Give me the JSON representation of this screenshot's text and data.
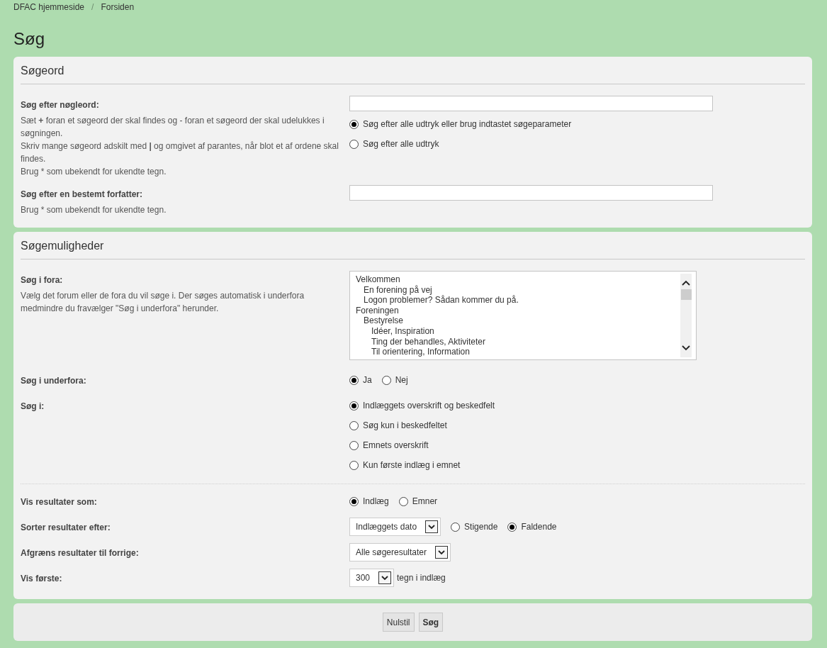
{
  "breadcrumbs": [
    {
      "label": "DFAC hjemmeside"
    },
    {
      "label": "Forsiden"
    }
  ],
  "breadcrumb_separator": "/",
  "title": "Søg",
  "panels": [
    {
      "heading": "Søgeord",
      "rows": [
        {
          "label": "Søg efter nøgleord:",
          "explain": [
            "Sæt **+** foran et søgeord der skal findes og - foran et søgeord der skal udelukkes i søgningen.",
            "Skriv mange søgeord adskilt med **|** og omgivet af parantes, når blot et af ordene skal findes.",
            "Brug * som ubekendt for ukendte tegn."
          ],
          "lines": [
            [
              {
                "kind": "text"
              }
            ],
            [
              {
                "kind": "radio",
                "label": "Søg efter alle udtryk eller brug indtastet søgeparameter",
                "selected": true
              }
            ],
            [
              {
                "kind": "radio",
                "label": "Søg efter alle udtryk",
                "selected": false
              }
            ]
          ]
        },
        {
          "label": "Søg efter en bestemt forfatter:",
          "explain": [
            "Brug * som ubekendt for ukendte tegn."
          ],
          "lines": [
            [
              {
                "kind": "text"
              }
            ]
          ]
        }
      ]
    },
    {
      "heading": "Søgemuligheder",
      "rows": [
        {
          "label": "Søg i fora:",
          "explain": [
            "Vælg det forum eller de fora du vil søge i. Der søges automatisk i underfora medmindre du fravælger \"Søg i underfora\" herunder."
          ],
          "lines": [
            [
              {
                "kind": "listbox",
                "items": [
                  {
                    "label": "Velkommen",
                    "selected": false,
                    "children": [
                      {
                        "label": "En forening på vej",
                        "selected": false
                      },
                      {
                        "label": "Logon problemer? Sådan kommer du på.",
                        "selected": false
                      }
                    ]
                  },
                  {
                    "label": "Foreningen",
                    "selected": false,
                    "children": [
                      {
                        "label": "Bestyrelse",
                        "selected": false,
                        "children": [
                          {
                            "label": "Idéer, Inspiration",
                            "selected": false
                          },
                          {
                            "label": "Ting der behandles, Aktiviteter",
                            "selected": false
                          },
                          {
                            "label": "Til orientering, Information",
                            "selected": false
                          }
                        ]
                      }
                    ]
                  }
                ]
              }
            ]
          ]
        },
        {
          "label": "Søg i underfora:",
          "lines": [
            [
              {
                "kind": "radio",
                "label": "Ja",
                "selected": true
              },
              {
                "kind": "radio",
                "label": "Nej",
                "selected": false
              }
            ]
          ]
        },
        {
          "label": "Søg i:",
          "lines": [
            [
              {
                "kind": "radio",
                "label": "Indlæggets overskrift og beskedfelt",
                "selected": true
              }
            ],
            [
              {
                "kind": "radio",
                "label": "Søg kun i beskedfeltet",
                "selected": false
              }
            ],
            [
              {
                "kind": "radio",
                "label": "Emnets overskrift",
                "selected": false
              }
            ],
            [
              {
                "kind": "radio",
                "label": "Kun første indlæg i emnet",
                "selected": false
              }
            ]
          ]
        },
        {
          "label": "Vis resultater som:",
          "divider_before": true,
          "lines": [
            [
              {
                "kind": "radio",
                "label": "Indlæg",
                "selected": true
              },
              {
                "kind": "radio",
                "label": "Emner",
                "selected": false
              }
            ]
          ]
        },
        {
          "label": "Sorter resultater efter:",
          "lines": [
            [
              {
                "kind": "select",
                "value": "Indlæggets dato"
              },
              {
                "kind": "radio",
                "label": "Stigende",
                "selected": false
              },
              {
                "kind": "radio",
                "label": "Faldende",
                "selected": true
              }
            ]
          ]
        },
        {
          "label": "Afgræns resultater til forrige:",
          "lines": [
            [
              {
                "kind": "select",
                "value": "Alle søgeresultater"
              }
            ]
          ]
        },
        {
          "label": "Vis første:",
          "lines": [
            [
              {
                "kind": "select",
                "value": "300"
              },
              {
                "kind": "suffix",
                "text": "tegn i indlæg"
              }
            ]
          ]
        }
      ]
    }
  ],
  "buttons": [
    {
      "label": "Nulstil",
      "kind": "reset"
    },
    {
      "label": "Søg",
      "kind": "submit"
    }
  ]
}
